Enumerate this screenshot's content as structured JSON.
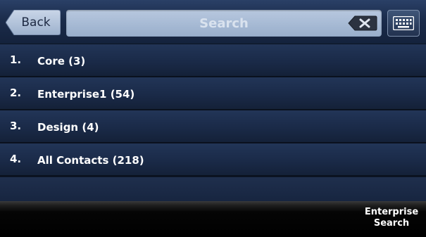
{
  "header": {
    "back_label": "Back",
    "search_placeholder": "Search",
    "clear_icon": "backspace-icon",
    "keyboard_icon": "keyboard-icon"
  },
  "directories": [
    {
      "number": "1.",
      "label": "Core (3)"
    },
    {
      "number": "2.",
      "label": "Enterprise1 (54)"
    },
    {
      "number": "3.",
      "label": "Design (4)"
    },
    {
      "number": "4.",
      "label": "All Contacts (218)"
    }
  ],
  "softkeys": {
    "enterprise_search_line1": "Enterprise",
    "enterprise_search_line2": "Search"
  },
  "colors": {
    "header_bg": "#1b2c4b",
    "row_bg": "#1a2a48",
    "search_field": "#a8bbd5",
    "text": "#ffffff"
  }
}
